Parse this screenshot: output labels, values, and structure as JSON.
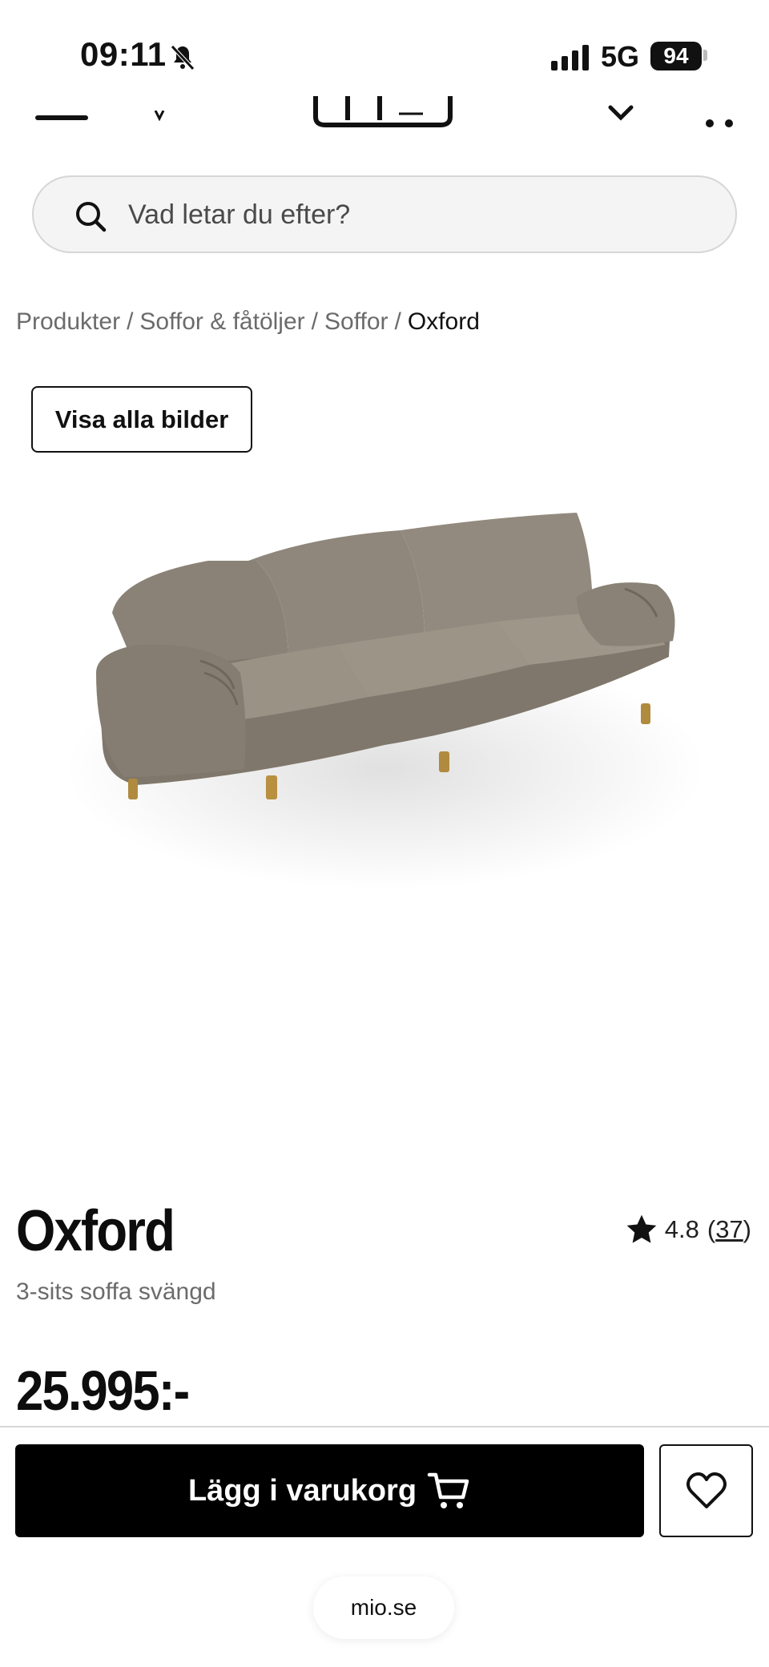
{
  "status_bar": {
    "time": "09:11",
    "network": "5G",
    "battery": "94"
  },
  "icons": {
    "menu": "menu-icon",
    "logo": "mio-logo",
    "chevron": "chevron-down-icon",
    "more": "more-icon",
    "search": "search-icon",
    "star": "star-icon",
    "cart": "cart-icon",
    "heart": "heart-icon"
  },
  "search": {
    "placeholder": "Vad letar du efter?"
  },
  "breadcrumb": {
    "items": [
      "Produkter",
      "Soffor & fåtöljer",
      "Soffor"
    ],
    "current": "Oxford",
    "separator": "/"
  },
  "gallery": {
    "view_all_label": "Visa alla bilder"
  },
  "product": {
    "name": "Oxford",
    "subtitle": "3-sits soffa svängd",
    "price": "25.995:-",
    "rating": "4.8",
    "review_count": "37",
    "rating_open": "(",
    "rating_close": ")"
  },
  "actions": {
    "add_to_cart_label": "Lägg i varukorg"
  },
  "browser": {
    "url": "mio.se"
  },
  "colors": {
    "primary": "#000000",
    "sofa": "#8c8478",
    "muted_text": "#6b6b6b"
  }
}
